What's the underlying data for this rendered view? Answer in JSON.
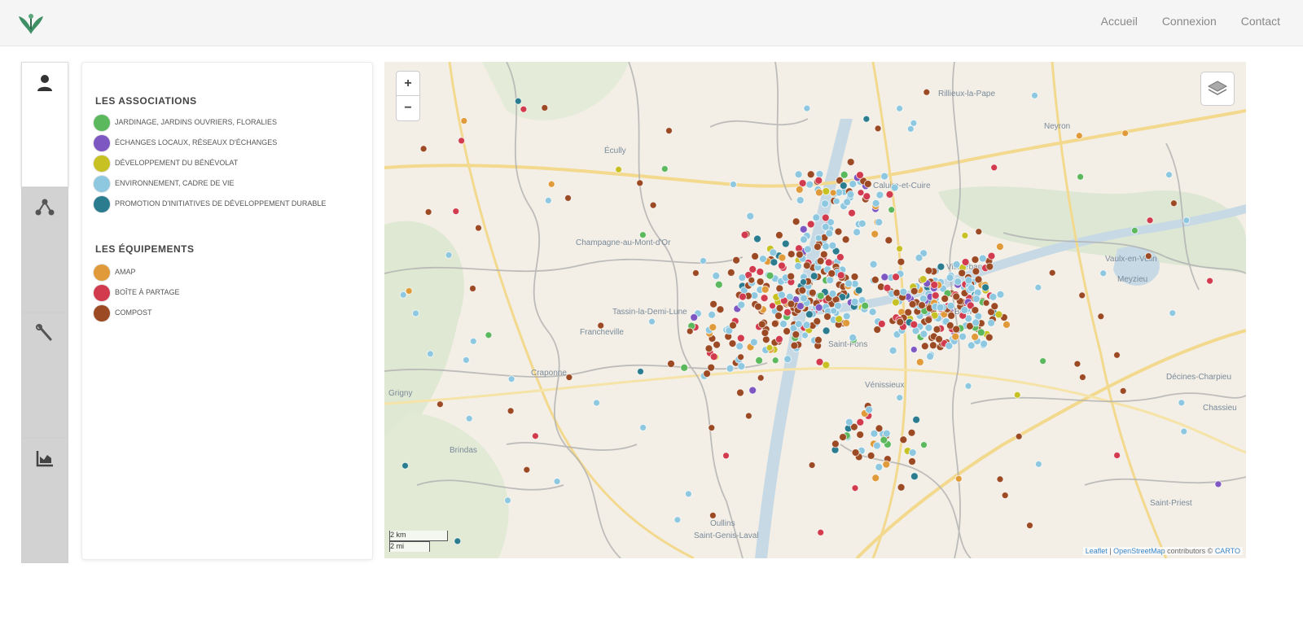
{
  "nav": {
    "links": [
      "Accueil",
      "Connexion",
      "Contact"
    ]
  },
  "sidebar": {
    "tabs": [
      {
        "icon": "user-icon",
        "active": true
      },
      {
        "icon": "network-icon",
        "active": false
      },
      {
        "icon": "tools-icon",
        "active": false
      },
      {
        "icon": "chart-icon",
        "active": false
      }
    ]
  },
  "legend": {
    "associations_title": "LES ASSOCIATIONS",
    "associations": [
      {
        "label": "JARDINAGE, JARDINS OUVRIERS, FLORALIES",
        "color": "#5cb85c"
      },
      {
        "label": "ÉCHANGES LOCAUX, RÉSEAUX D'ÉCHANGES",
        "color": "#7e57c2"
      },
      {
        "label": "DÉVELOPPEMENT DU BÉNÉVOLAT",
        "color": "#c7c124"
      },
      {
        "label": "ENVIRONNEMENT, CADRE DE VIE",
        "color": "#8ec8e0"
      },
      {
        "label": "PROMOTION D'INITIATIVES DE DÉVELOPPEMENT DURABLE",
        "color": "#2a7c8e"
      }
    ],
    "equipements_title": "LES ÉQUIPEMENTS",
    "equipements": [
      {
        "label": "AMAP",
        "color": "#e09a3a"
      },
      {
        "label": "BOÎTE À PARTAGE",
        "color": "#d23a4e"
      },
      {
        "label": "COMPOST",
        "color": "#9c4a23"
      }
    ]
  },
  "map": {
    "zoom_in": "+",
    "zoom_out": "−",
    "scale_labels": [
      "2 km",
      "2 mi"
    ],
    "attribution_prefix": "Leaflet",
    "attribution_osm": "OpenStreetMap",
    "attribution_suffix": "contributors ©",
    "attribution_carto": "CARTO",
    "place_labels": [
      "Rillieux-la-Pape",
      "Neyron",
      "Caluire-et-Cuire",
      "Villeurbanne",
      "Vaulx-en-Velin",
      "Bron",
      "Vénissieux",
      "Saint-Fons",
      "Oullins",
      "Francheville",
      "Tassin-la-Demi-Lune",
      "Écully",
      "Champagne-au-Mont-d'Or",
      "Saint-Genis-Laval",
      "Meyzieu",
      "Décines-Charpieu",
      "Chassieu",
      "Saint-Priest",
      "Craponne",
      "Brindas",
      "Grigny"
    ]
  }
}
